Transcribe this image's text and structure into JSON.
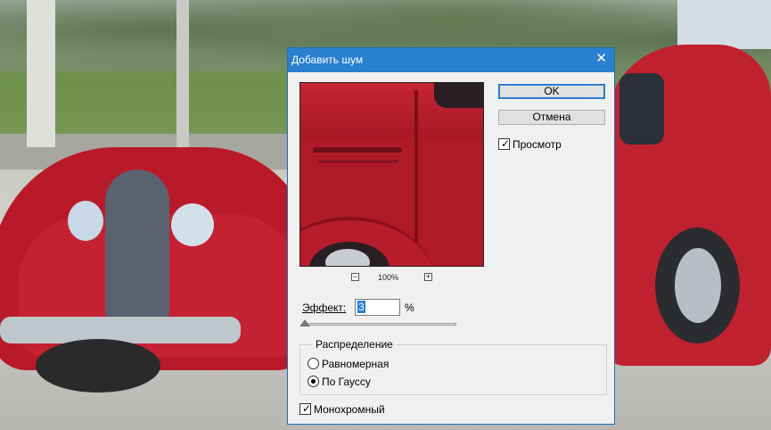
{
  "dialog": {
    "title": "Добавить шум",
    "close_glyph": "✕",
    "ok_label": "OK",
    "cancel_label": "Отмена",
    "preview": {
      "label": "Просмотр",
      "checked": true
    },
    "zoom": {
      "minus": "−",
      "level": "100%",
      "plus": "+"
    },
    "effect": {
      "label": "Эффект:",
      "value": "3",
      "unit": "%"
    },
    "distribution": {
      "title": "Распределение",
      "options": [
        {
          "label": "Равномерная",
          "selected": false
        },
        {
          "label": "По Гауссу",
          "selected": true
        }
      ]
    },
    "monochrome": {
      "label": "Монохромный",
      "checked": true
    }
  },
  "colors": {
    "titlebar": "#2b7fcf",
    "accent_border": "#2b7fcf",
    "dialog_bg": "#f0f0f0"
  },
  "icons": {
    "close": "close-icon",
    "check": "checkmark-icon"
  }
}
